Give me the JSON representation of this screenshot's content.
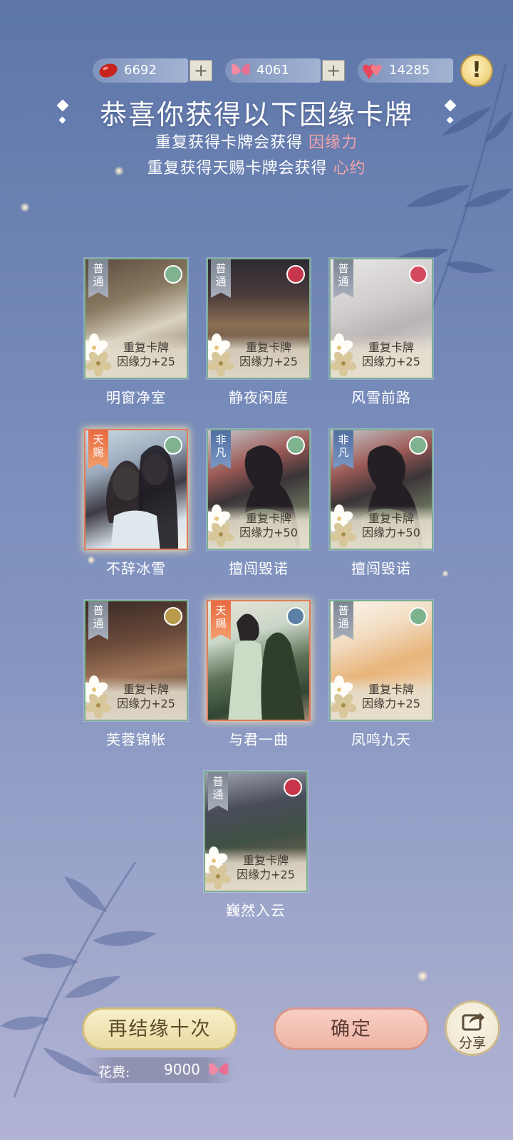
{
  "resources": [
    {
      "icon": "red-bean-icon",
      "value": "6692",
      "has_plus": true
    },
    {
      "icon": "butterfly-icon",
      "value": "4061",
      "has_plus": true
    },
    {
      "icon": "hearts-icon",
      "value": "14285",
      "has_plus": false
    }
  ],
  "header": {
    "title": "恭喜你获得以下因缘卡牌",
    "line1_prefix": "重复获得卡牌会获得",
    "line1_highlight": "因缘力",
    "line2_prefix": "重复获得天赐卡牌会获得",
    "line2_highlight": "心约"
  },
  "cards": [
    {
      "name": "明窗净室",
      "rank": "普通",
      "duplicate": true,
      "dup_title": "重复卡牌",
      "dup_reward": "因缘力+25",
      "theme": "interior"
    },
    {
      "name": "静夜闲庭",
      "rank": "普通",
      "duplicate": true,
      "dup_title": "重复卡牌",
      "dup_reward": "因缘力+25",
      "theme": "gate"
    },
    {
      "name": "风雪前路",
      "rank": "普通",
      "duplicate": true,
      "dup_title": "重复卡牌",
      "dup_reward": "因缘力+25",
      "theme": "snow"
    },
    {
      "name": "不辞冰雪",
      "rank": "天赐",
      "duplicate": false,
      "theme": "couple-snow"
    },
    {
      "name": "擅闯毁诺",
      "rank": "非凡",
      "duplicate": true,
      "dup_title": "重复卡牌",
      "dup_reward": "因缘力+50",
      "theme": "back"
    },
    {
      "name": "擅闯毁诺",
      "rank": "非凡",
      "duplicate": true,
      "dup_title": "重复卡牌",
      "dup_reward": "因缘力+50",
      "theme": "back"
    },
    {
      "name": "芙蓉锦帐",
      "rank": "普通",
      "duplicate": true,
      "dup_title": "重复卡牌",
      "dup_reward": "因缘力+25",
      "theme": "room"
    },
    {
      "name": "与君一曲",
      "rank": "天赐",
      "duplicate": false,
      "theme": "couple-green"
    },
    {
      "name": "凤鸣九天",
      "rank": "普通",
      "duplicate": true,
      "dup_title": "重复卡牌",
      "dup_reward": "因缘力+25",
      "theme": "phoenix"
    },
    {
      "name": "巍然入云",
      "rank": "普通",
      "duplicate": true,
      "dup_title": "重复卡牌",
      "dup_reward": "因缘力+25",
      "theme": "tower"
    }
  ],
  "buttons": {
    "again": "再结缘十次",
    "ok": "确定",
    "share": "分享"
  },
  "cost": {
    "label": "花费:",
    "value": "9000",
    "icon": "butterfly-icon"
  },
  "colors": {
    "highlight": "#f4a3a8",
    "gift_rank": "#e8693f",
    "rare_rank": "#4f6fa2",
    "normal_rank": "#7d8593"
  }
}
